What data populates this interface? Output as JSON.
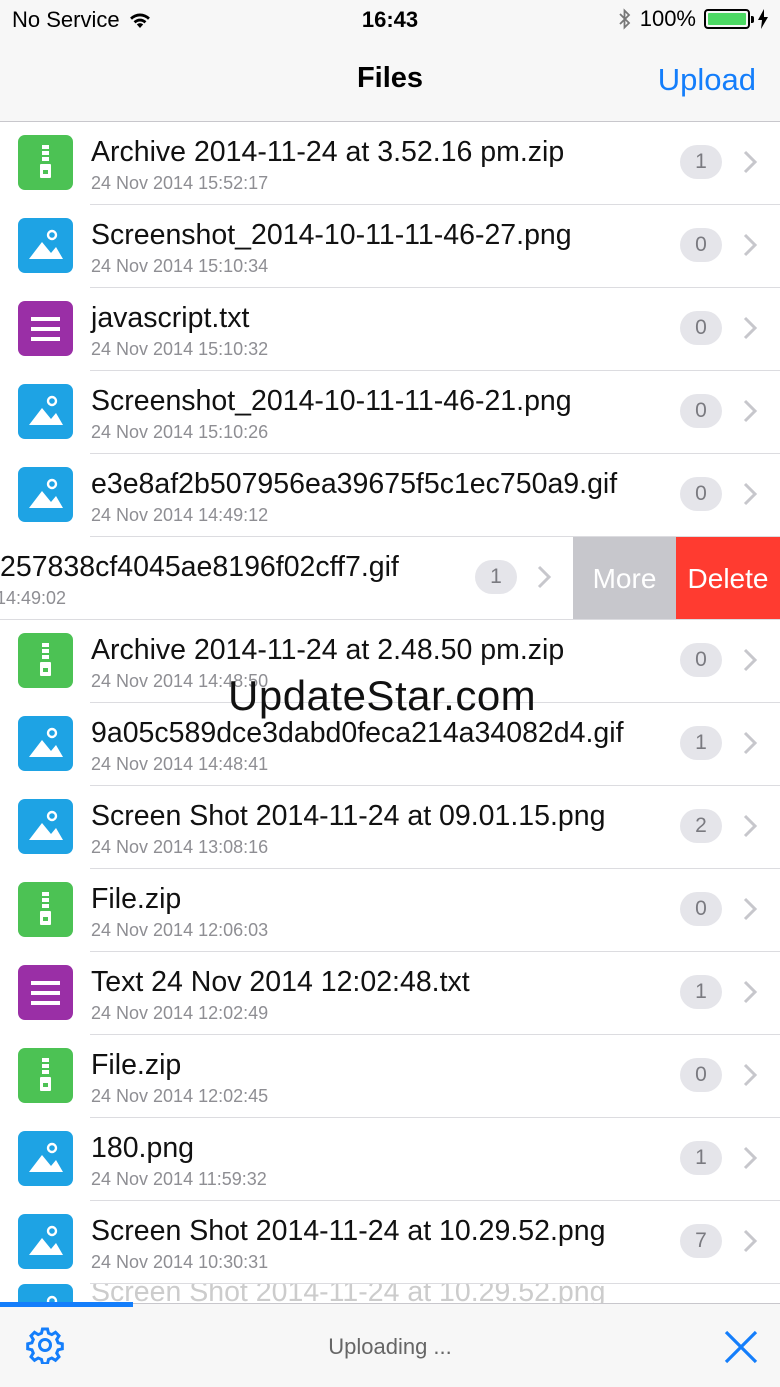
{
  "status_bar": {
    "carrier": "No Service",
    "time": "16:43",
    "battery": "100%"
  },
  "nav": {
    "title": "Files",
    "upload_label": "Upload"
  },
  "files": [
    {
      "name": "Archive 2014-11-24 at 3.52.16 pm.zip",
      "date": "24 Nov 2014 15:52:17",
      "count": "1",
      "type": "zip",
      "icon": "zip-file-icon"
    },
    {
      "name": "Screenshot_2014-10-11-11-46-27.png",
      "date": "24 Nov 2014 15:10:34",
      "count": "0",
      "type": "image",
      "icon": "image-file-icon"
    },
    {
      "name": "javascript.txt",
      "date": "24 Nov 2014 15:10:32",
      "count": "0",
      "type": "text",
      "icon": "text-file-icon"
    },
    {
      "name": "Screenshot_2014-10-11-11-46-21.png",
      "date": "24 Nov 2014 15:10:26",
      "count": "0",
      "type": "image",
      "icon": "image-file-icon"
    },
    {
      "name": "e3e8af2b507956ea39675f5c1ec750a9.gif",
      "date": "24 Nov 2014 14:49:12",
      "count": "0",
      "type": "image",
      "icon": "image-file-icon"
    },
    {
      "name": "257838cf4045ae8196f02cff7.gif",
      "date": "14:49:02",
      "count": "1",
      "type": "image",
      "icon": "image-file-icon",
      "swiped": true
    },
    {
      "name": "Archive 2014-11-24 at 2.48.50 pm.zip",
      "date": "24 Nov 2014 14:48:50",
      "count": "0",
      "type": "zip",
      "icon": "zip-file-icon"
    },
    {
      "name": "9a05c589dce3dabd0feca214a34082d4.gif",
      "date": "24 Nov 2014 14:48:41",
      "count": "1",
      "type": "image",
      "icon": "image-file-icon"
    },
    {
      "name": "Screen Shot 2014-11-24 at 09.01.15.png",
      "date": "24 Nov 2014 13:08:16",
      "count": "2",
      "type": "image",
      "icon": "image-file-icon"
    },
    {
      "name": "File.zip",
      "date": "24 Nov 2014 12:06:03",
      "count": "0",
      "type": "zip",
      "icon": "zip-file-icon"
    },
    {
      "name": "Text 24 Nov 2014 12:02:48.txt",
      "date": "24 Nov 2014 12:02:49",
      "count": "1",
      "type": "text",
      "icon": "text-file-icon"
    },
    {
      "name": "File.zip",
      "date": "24 Nov 2014 12:02:45",
      "count": "0",
      "type": "zip",
      "icon": "zip-file-icon"
    },
    {
      "name": "180.png",
      "date": "24 Nov 2014 11:59:32",
      "count": "1",
      "type": "image",
      "icon": "image-file-icon"
    },
    {
      "name": "Screen Shot 2014-11-24 at 10.29.52.png",
      "date": "24 Nov 2014 10:30:31",
      "count": "7",
      "type": "image",
      "icon": "image-file-icon"
    },
    {
      "name": "Screen Shot 2014-11-24 at 10.29.52.png",
      "date": "",
      "count": "",
      "type": "image",
      "icon": "image-file-icon",
      "partial": true
    }
  ],
  "swipe_actions": {
    "more_label": "More",
    "delete_label": "Delete"
  },
  "watermark": "UpdateStar.com",
  "toolbar": {
    "status_text": "Uploading ...",
    "settings_icon": "gear-icon",
    "close_icon": "close-icon",
    "upload_progress": 0.17
  },
  "colors": {
    "accent": "#147efb",
    "zip": "#4cc254",
    "image": "#1ea3e4",
    "text": "#9a2fa6",
    "delete": "#ff3b30",
    "more": "#c7c7cc",
    "battery": "#4cd964"
  }
}
